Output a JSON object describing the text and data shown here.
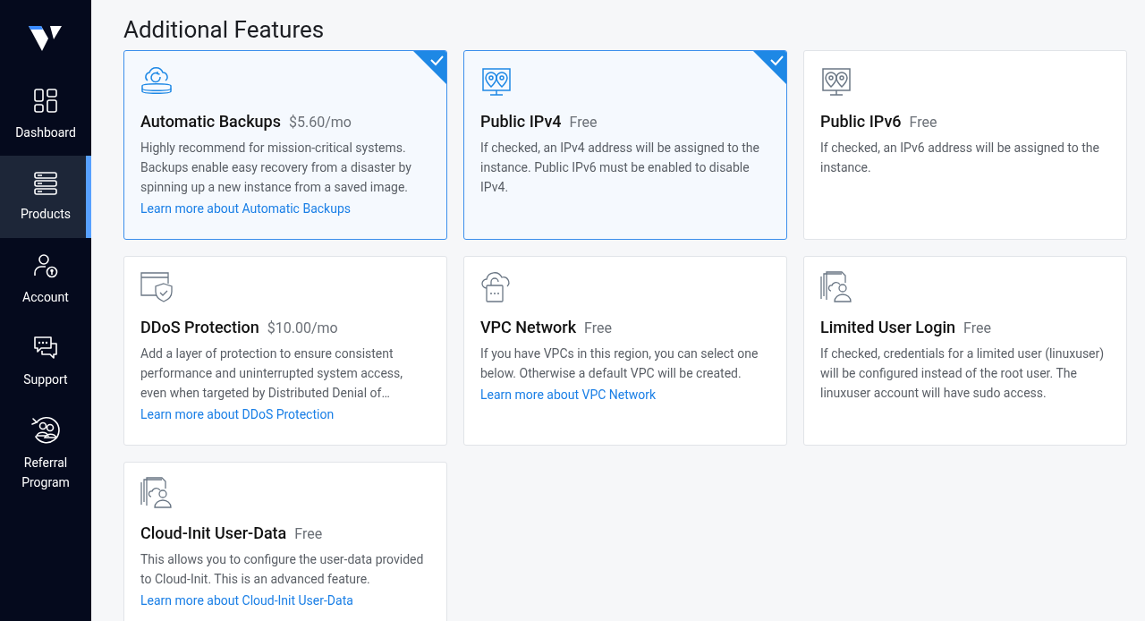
{
  "sidebar": {
    "items": [
      {
        "label": "Dashboard",
        "kind": "grid",
        "selected": false
      },
      {
        "label": "Products",
        "kind": "servers",
        "selected": true
      },
      {
        "label": "Account",
        "kind": "user-lock",
        "selected": false
      },
      {
        "label": "Support",
        "kind": "chat",
        "selected": false
      },
      {
        "label": "Referral Program",
        "kind": "referral",
        "selected": false
      }
    ]
  },
  "heading": "Additional Features",
  "features": [
    {
      "title": "Automatic Backups",
      "price": "$5.60/mo",
      "kind": "backup",
      "checked": true,
      "description": "Highly recommend for mission-critical systems. Backups enable easy recovery from a disaster by spinning up a new instance from a saved image.",
      "link": "Learn more about Automatic Backups"
    },
    {
      "title": "Public IPv4",
      "price": "Free",
      "kind": "location",
      "checked": true,
      "description": "If checked, an IPv4 address will be assigned to the instance. Public IPv6 must be enabled to disable IPv4."
    },
    {
      "title": "Public IPv6",
      "price": "Free",
      "kind": "location",
      "checked": false,
      "description": "If checked, an IPv6 address will be assigned to the instance."
    },
    {
      "title": "DDoS Protection",
      "price": "$10.00/mo",
      "kind": "shield",
      "checked": false,
      "description": "Add a layer of protection to ensure consistent performance and uninterrupted system access, even when targeted by Distributed Denial of…",
      "link": "Learn more about DDoS Protection"
    },
    {
      "title": "VPC Network",
      "price": "Free",
      "kind": "lock-cloud",
      "checked": false,
      "description": "If you have VPCs in this region, you can select one below. Otherwise a default VPC will be created.",
      "link": "Learn more about VPC Network"
    },
    {
      "title": "Limited User Login",
      "price": "Free",
      "kind": "user-docs",
      "checked": false,
      "description": "If checked, credentials for a limited user (linuxuser) will be configured instead of the root user. The linuxuser account will have sudo access."
    },
    {
      "title": "Cloud-Init User-Data",
      "price": "Free",
      "kind": "user-docs",
      "checked": false,
      "description": "This allows you to configure the user-data provided to Cloud-Init. This is an advanced feature.",
      "link": "Learn more about Cloud-Init User-Data"
    }
  ]
}
